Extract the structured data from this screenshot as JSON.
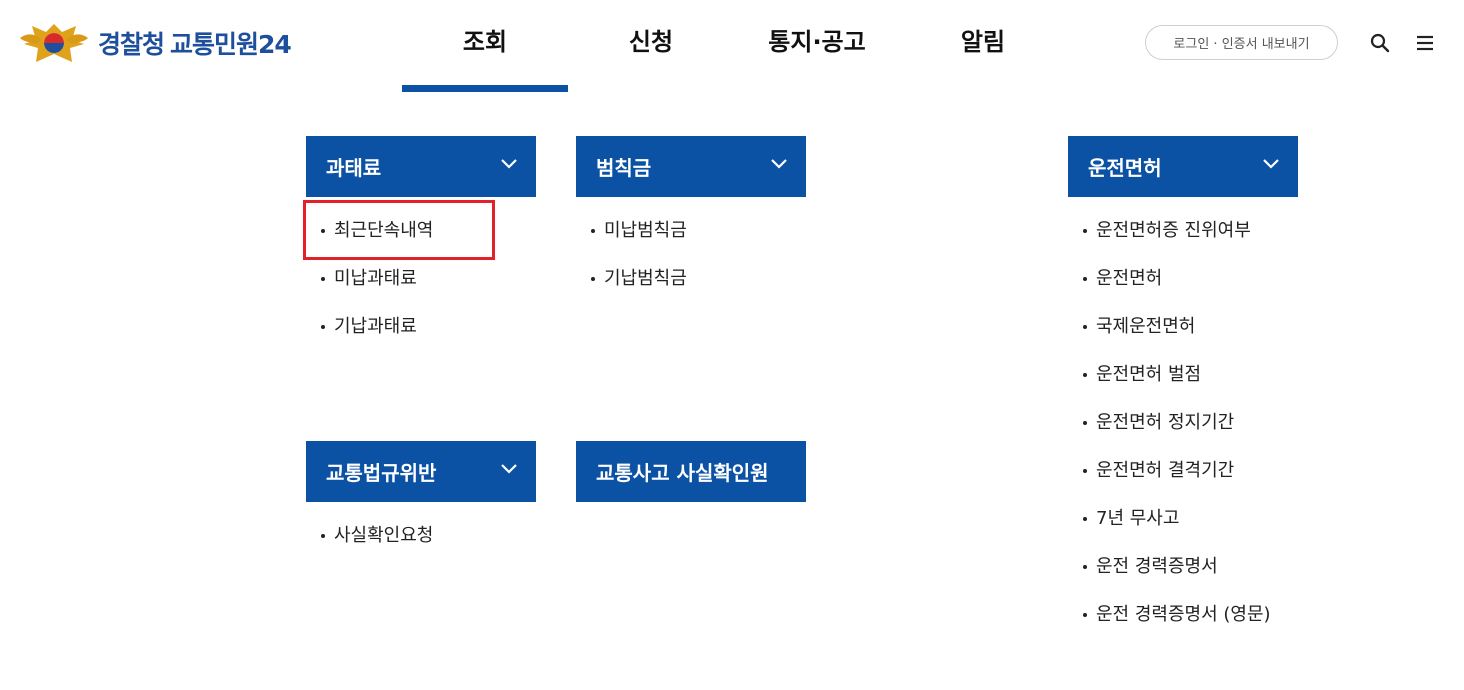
{
  "brand": {
    "org": "경찰청",
    "service": "교통민원24"
  },
  "nav": [
    {
      "label": "조회",
      "active": true
    },
    {
      "label": "신청",
      "active": false
    },
    {
      "label": "통지·공고",
      "active": false
    },
    {
      "label": "알림",
      "active": false
    }
  ],
  "utility": {
    "login_label": "로그인 · 인증서 내보내기",
    "search_icon": "search-icon",
    "menu_icon": "hamburger-menu-icon"
  },
  "colors": {
    "primary": "#0b52a5",
    "highlight": "#e2212a"
  },
  "menu": {
    "fine": {
      "title": "과태료",
      "items": [
        "최근단속내역",
        "미납과태료",
        "기납과태료"
      ]
    },
    "penalty": {
      "title": "범칙금",
      "items": [
        "미납범칙금",
        "기납범칙금"
      ]
    },
    "license": {
      "title": "운전면허",
      "items": [
        "운전면허증 진위여부",
        "운전면허",
        "국제운전면허",
        "운전면허 벌점",
        "운전면허 정지기간",
        "운전면허 결격기간",
        "7년 무사고",
        "운전 경력증명서",
        "운전 경력증명서 (영문)"
      ]
    },
    "violation": {
      "title": "교통법규위반",
      "items": [
        "사실확인요청"
      ]
    },
    "accident": {
      "title": "교통사고 사실확인원",
      "items": []
    }
  }
}
